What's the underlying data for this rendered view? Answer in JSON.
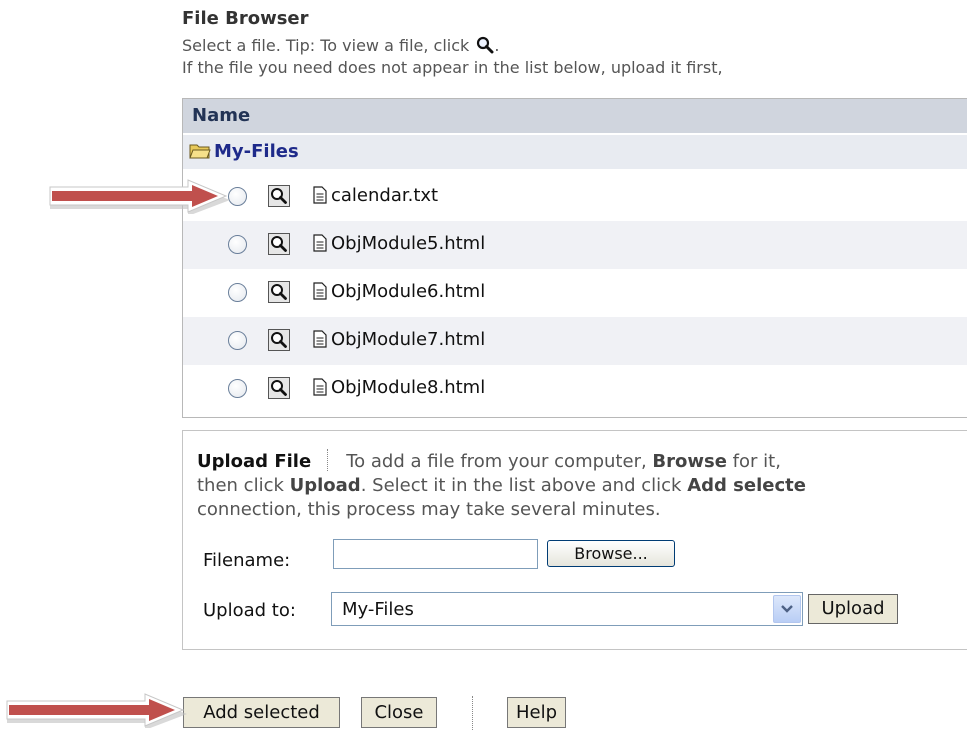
{
  "header": {
    "title": "File Browser",
    "tip_line1": "Select a file. Tip: To view a file, click",
    "tip_line1_end": ".",
    "tip_line2": "If the file you need does not appear in the list below, upload it first,"
  },
  "file_list": {
    "column_header": "Name",
    "root_folder": "My-Files",
    "files": [
      {
        "name": "calendar.txt"
      },
      {
        "name": "ObjModule5.html"
      },
      {
        "name": "ObjModule6.html"
      },
      {
        "name": "ObjModule7.html"
      },
      {
        "name": "ObjModule8.html"
      }
    ]
  },
  "upload": {
    "title": "Upload File",
    "desc_part1": "To add a file from your computer,",
    "browse_word": "Browse",
    "desc_part2": "for it,",
    "desc_line2_a": "then click",
    "upload_word": "Upload",
    "desc_line2_b": ". Select it in the list above and click",
    "add_selected_word": "Add selecte",
    "desc_line3": "connection, this process may take several minutes.",
    "filename_label": "Filename:",
    "filename_value": "",
    "browse_label": "Browse...",
    "upload_to_label": "Upload to:",
    "upload_to_value": "My-Files",
    "upload_button": "Upload"
  },
  "footer": {
    "add_selected": "Add selected",
    "close": "Close",
    "help": "Help"
  },
  "colors": {
    "header_bg": "#d0d5de",
    "folder_text": "#1e2a8a",
    "arrow_red": "#c0504d"
  }
}
